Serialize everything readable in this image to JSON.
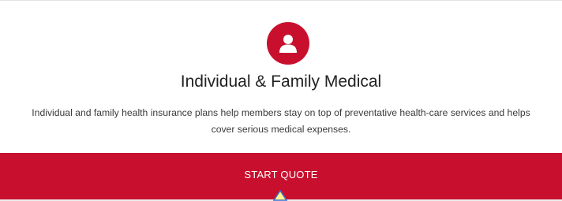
{
  "card": {
    "icon": "user-icon",
    "title": "Individual & Family Medical",
    "description": "Individual and family health insurance plans help members stay on top of preventative health-care services and helps cover serious medical expenses.",
    "cta_label": "START QUOTE"
  },
  "colors": {
    "brand_red": "#c8102e",
    "background": "#ffffff",
    "title_text": "#222222",
    "body_text": "#3a3a3a"
  }
}
